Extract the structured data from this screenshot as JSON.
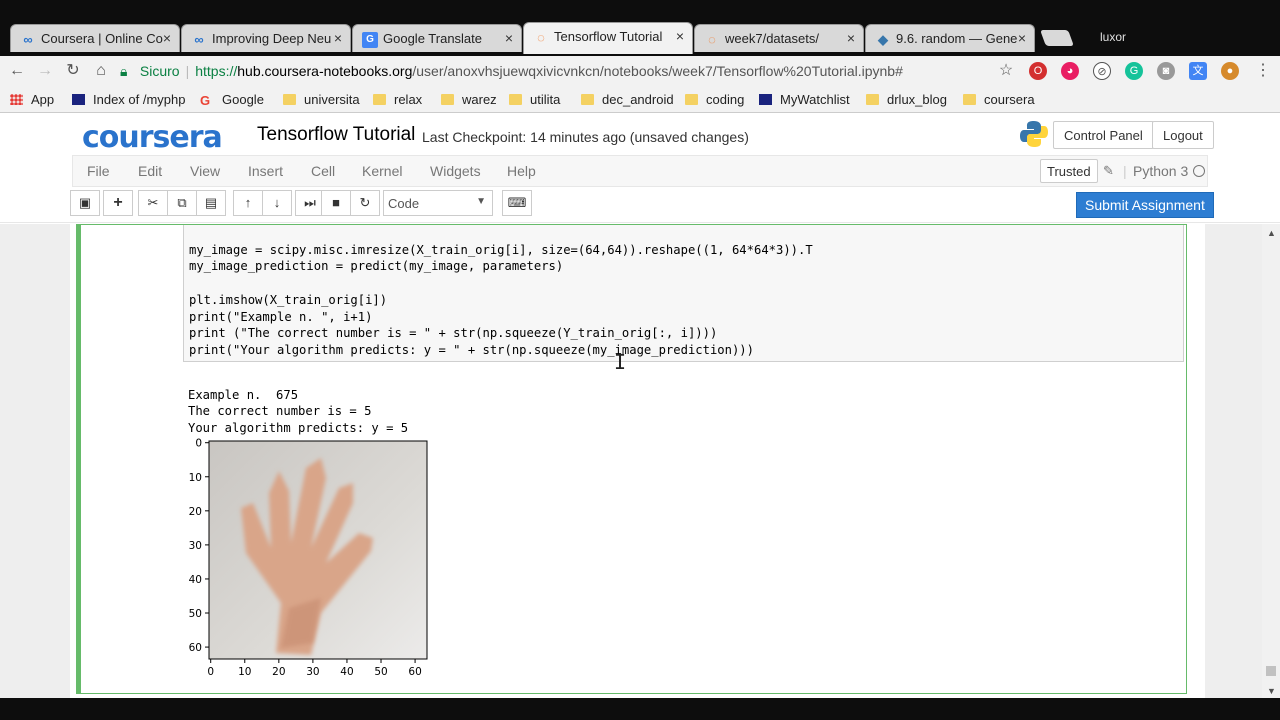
{
  "browser": {
    "tabs": [
      {
        "title": "Coursera | Online Co",
        "icon": "coursera-icon"
      },
      {
        "title": "Improving Deep Neu",
        "icon": "coursera-icon"
      },
      {
        "title": "Google Translate",
        "icon": "translate-icon"
      },
      {
        "title": "Tensorflow Tutorial",
        "icon": "jupyter-icon",
        "active": true
      },
      {
        "title": "week7/datasets/",
        "icon": "jupyter-icon"
      },
      {
        "title": "9.6. random — Gene",
        "icon": "python-icon"
      }
    ],
    "profile_name": "luxor",
    "address": {
      "security_label": "Sicuro",
      "url_scheme": "https://",
      "url_host": "hub.coursera-notebooks.org",
      "url_path": "/user/anoxvhsjuewqxivicvnkcn/notebooks/week7/Tensorflow%20Tutorial.ipynb#"
    },
    "bookmarks": [
      {
        "label": "App",
        "icon": "apps-grid-icon"
      },
      {
        "label": "Index of /myphp",
        "icon": "bookmark-page-icon"
      },
      {
        "label": "Google",
        "icon": "google-icon"
      },
      {
        "label": "universita",
        "icon": "folder-icon"
      },
      {
        "label": "relax",
        "icon": "folder-icon"
      },
      {
        "label": "warez",
        "icon": "folder-icon"
      },
      {
        "label": "utilita",
        "icon": "folder-icon"
      },
      {
        "label": "dec_android",
        "icon": "folder-icon"
      },
      {
        "label": "coding",
        "icon": "folder-icon"
      },
      {
        "label": "MyWatchlist",
        "icon": "bookmark-page-icon"
      },
      {
        "label": "drlux_blog",
        "icon": "folder-icon"
      },
      {
        "label": "coursera",
        "icon": "folder-icon"
      }
    ]
  },
  "jupyter": {
    "brand": "coursera",
    "notebook_title": "Tensorflow Tutorial",
    "checkpoint": "Last Checkpoint: 14 minutes ago (unsaved changes)",
    "control_panel": "Control Panel",
    "logout": "Logout",
    "menus": [
      "File",
      "Edit",
      "View",
      "Insert",
      "Cell",
      "Kernel",
      "Widgets",
      "Help"
    ],
    "trusted": "Trusted",
    "kernel": "Python 3",
    "cell_type": "Code",
    "submit": "Submit Assignment"
  },
  "cell": {
    "code_lines": [
      "my_image = scipy.misc.imresize(X_train_orig[i], size=(64,64)).reshape((1, 64*64*3)).T",
      "my_image_prediction = predict(my_image, parameters)",
      "",
      "plt.imshow(X_train_orig[i])",
      "print(\"Example n. \", i+1)",
      "print (\"The correct number is = \" + str(np.squeeze(Y_train_orig[:, i])))",
      "print(\"Your algorithm predicts: y = \" + str(np.squeeze(my_image_prediction)))"
    ],
    "output_lines": [
      "Example n.  675",
      "The correct number is = 5",
      "Your algorithm predicts: y = 5"
    ]
  },
  "chart_data": {
    "type": "image",
    "xticks": [
      "0",
      "10",
      "20",
      "30",
      "40",
      "50",
      "60"
    ],
    "yticks": [
      "0",
      "10",
      "20",
      "30",
      "40",
      "50",
      "60"
    ],
    "xlim": [
      -0.5,
      63.5
    ],
    "ylim": [
      63.5,
      -0.5
    ]
  },
  "colors": {
    "coursera_blue": "#2a73cc",
    "cell_selected_border": "#66bb6a",
    "submit_button": "#2d7dd2"
  }
}
